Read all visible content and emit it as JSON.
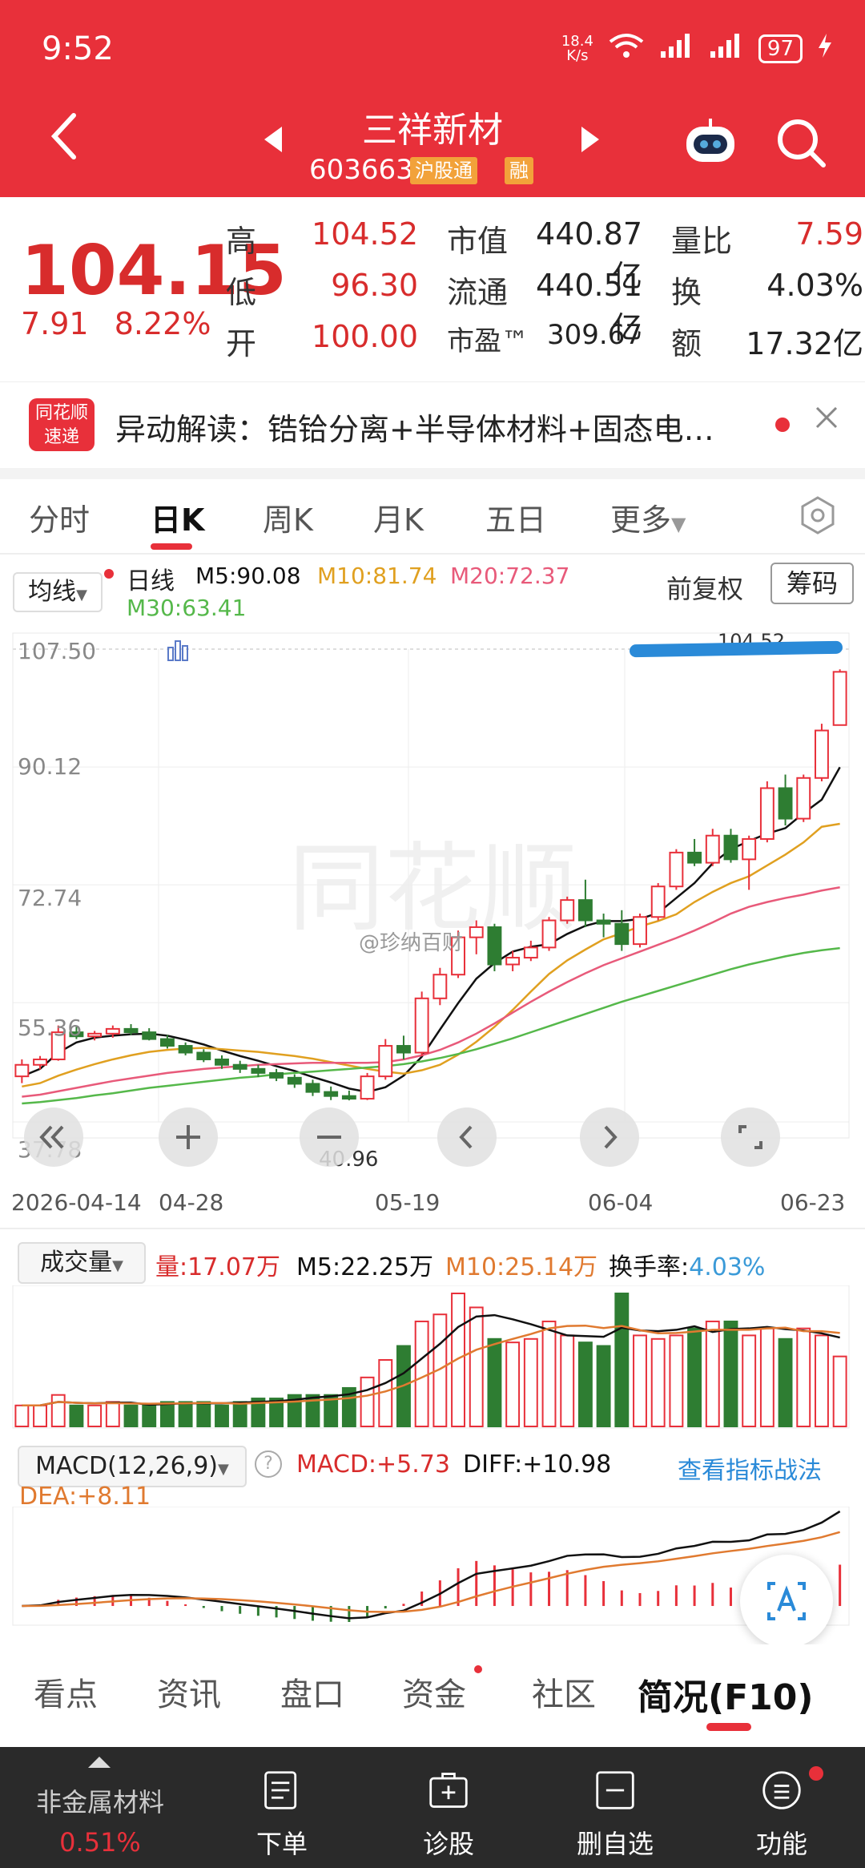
{
  "status": {
    "time": "9:52",
    "speed_value": "18.4",
    "speed_unit": "K/s",
    "battery": "97"
  },
  "stock": {
    "name": "三祥新材",
    "code": "603663",
    "tags": [
      "沪股通",
      "融"
    ]
  },
  "quote": {
    "price": "104.15",
    "change": "7.91",
    "change_pct": "8.22%",
    "cells": [
      {
        "k": "高",
        "v": "104.52"
      },
      {
        "k": "市值",
        "v": "440.87亿"
      },
      {
        "k": "量比",
        "v": "7.59"
      },
      {
        "k": "低",
        "v": "96.30"
      },
      {
        "k": "流通",
        "v": "440.51亿"
      },
      {
        "k": "换",
        "v": "4.03%"
      },
      {
        "k": "开",
        "v": "100.00"
      },
      {
        "k": "市盈™",
        "v": "309.67"
      },
      {
        "k": "额",
        "v": "17.32亿"
      }
    ]
  },
  "notice": {
    "logo_top": "同花顺",
    "logo_bottom": "速递",
    "text": "异动解读：锆铪分离+半导体材料+固态电…"
  },
  "tabs": [
    "分时",
    "日K",
    "周K",
    "月K",
    "五日",
    "更多"
  ],
  "kline": {
    "indicator": "均线",
    "period": "日线",
    "ma5": "M5:90.08",
    "ma10": "M10:81.74",
    "ma20": "M20:72.37",
    "ma30": "M30:63.41",
    "adjust": "前复权",
    "chips": "筹码",
    "high_mark": "104.52",
    "low_mark": "40.96",
    "colors": {
      "ma5": "#111111",
      "ma10": "#e0a020",
      "ma20": "#e85a7a",
      "ma30": "#55b84a"
    }
  },
  "volume": {
    "label": "成交量",
    "vol": "量:17.07万",
    "m5": "M5:22.25万",
    "m10": "M10:25.14万",
    "turnover_label": "换手率:",
    "turnover": "4.03%"
  },
  "macd": {
    "label": "MACD(12,26,9)",
    "macd": "MACD:+5.73",
    "diff": "DIFF:+10.98",
    "dea": "DEA:+8.11",
    "link": "查看指标战法"
  },
  "watermark": "同花顺",
  "weibo": "@珍纳百财",
  "bottom_tabs": [
    "看点",
    "资讯",
    "盘口",
    "资金",
    "社区",
    "简况(F10)"
  ],
  "dock": [
    {
      "label": "非金属材料",
      "sub": "0.51%"
    },
    {
      "label": "下单"
    },
    {
      "label": "诊股"
    },
    {
      "label": "删自选"
    },
    {
      "label": "功能"
    }
  ],
  "chart_data": {
    "type": "candlestick",
    "y_ticks": [
      "107.50",
      "90.12",
      "72.74",
      "55.36",
      "37.78"
    ],
    "x_ticks": [
      "2026-04-14",
      "04-28",
      "05-19",
      "06-04",
      "06-23"
    ],
    "ylim": [
      37.78,
      107.5
    ],
    "candles": [
      [
        44.5,
        47.0,
        43.5,
        46.2
      ],
      [
        46.2,
        47.5,
        45.5,
        47.0
      ],
      [
        47.0,
        52.0,
        46.8,
        51.0
      ],
      [
        51.0,
        51.8,
        50.0,
        50.4
      ],
      [
        50.4,
        51.2,
        49.8,
        50.8
      ],
      [
        50.8,
        52.0,
        50.2,
        51.5
      ],
      [
        51.5,
        52.2,
        50.6,
        51.0
      ],
      [
        51.0,
        51.6,
        49.8,
        50.0
      ],
      [
        50.0,
        50.6,
        48.6,
        49.0
      ],
      [
        49.0,
        49.5,
        47.6,
        48.0
      ],
      [
        48.0,
        48.5,
        46.6,
        47.0
      ],
      [
        47.0,
        47.6,
        45.6,
        46.2
      ],
      [
        46.2,
        46.8,
        45.0,
        45.6
      ],
      [
        45.6,
        46.2,
        44.4,
        45.0
      ],
      [
        45.0,
        45.6,
        43.8,
        44.3
      ],
      [
        44.3,
        44.8,
        42.8,
        43.4
      ],
      [
        43.4,
        44.0,
        41.6,
        42.2
      ],
      [
        42.2,
        43.0,
        41.0,
        41.6
      ],
      [
        41.6,
        42.4,
        40.96,
        41.2
      ],
      [
        41.2,
        45.0,
        41.0,
        44.5
      ],
      [
        44.5,
        50.0,
        44.0,
        49.0
      ],
      [
        49.0,
        50.5,
        47.0,
        48.0
      ],
      [
        48.0,
        57.0,
        47.5,
        56.0
      ],
      [
        56.0,
        60.5,
        55.0,
        59.5
      ],
      [
        59.5,
        66.0,
        59.0,
        65.0
      ],
      [
        65.0,
        67.5,
        62.5,
        66.5
      ],
      [
        66.5,
        67.0,
        60.0,
        61.0
      ],
      [
        61.0,
        63.0,
        60.0,
        62.0
      ],
      [
        62.0,
        64.5,
        61.5,
        63.5
      ],
      [
        63.5,
        68.0,
        63.0,
        67.5
      ],
      [
        67.5,
        71.0,
        67.0,
        70.5
      ],
      [
        70.5,
        73.5,
        66.5,
        67.5
      ],
      [
        67.5,
        68.5,
        65.0,
        67.0
      ],
      [
        67.0,
        69.0,
        63.0,
        64.0
      ],
      [
        64.0,
        68.5,
        63.5,
        68.0
      ],
      [
        68.0,
        73.0,
        67.5,
        72.5
      ],
      [
        72.5,
        78.0,
        72.0,
        77.5
      ],
      [
        77.5,
        79.5,
        75.5,
        76.0
      ],
      [
        76.0,
        81.0,
        75.5,
        80.0
      ],
      [
        80.0,
        81.0,
        76.0,
        76.5
      ],
      [
        76.5,
        80.0,
        72.0,
        79.5
      ],
      [
        79.5,
        88.0,
        79.0,
        87.0
      ],
      [
        87.0,
        89.0,
        81.5,
        82.5
      ],
      [
        82.5,
        89.0,
        82.0,
        88.5
      ],
      [
        88.5,
        96.5,
        88.0,
        95.5
      ],
      [
        96.3,
        104.52,
        96.3,
        104.15
      ]
    ],
    "volume": [
      6,
      6,
      9,
      6,
      6,
      7,
      6,
      6,
      7,
      7,
      7,
      6,
      7,
      8,
      8,
      9,
      9,
      9,
      11,
      14,
      19,
      23,
      30,
      32,
      38,
      34,
      25,
      24,
      25,
      30,
      26,
      24,
      23,
      38,
      26,
      25,
      26,
      28,
      30,
      30,
      26,
      28,
      25,
      28,
      26,
      20
    ],
    "ma_lines": {
      "ma5": [
        44.5,
        45.6,
        48.0,
        49.5,
        50.2,
        50.5,
        50.7,
        50.8,
        50.5,
        49.9,
        49.2,
        48.3,
        47.5,
        46.8,
        46.0,
        45.3,
        44.4,
        43.6,
        42.7,
        42.2,
        42.9,
        44.6,
        47.4,
        51.4,
        55.3,
        58.9,
        61.2,
        62.9,
        63.6,
        64.0,
        65.5,
        66.7,
        67.4,
        67.4,
        67.7,
        68.6,
        70.8,
        73.0,
        75.9,
        78.0,
        79.2,
        80.3,
        81.1,
        83.3,
        85.3,
        90.08
      ],
      "ma10": [
        43.0,
        43.5,
        44.6,
        45.5,
        46.3,
        47.0,
        47.6,
        48.1,
        48.4,
        48.6,
        48.7,
        48.5,
        48.3,
        48.1,
        47.8,
        47.5,
        47.1,
        46.6,
        46.1,
        45.6,
        45.2,
        44.9,
        45.4,
        46.2,
        47.7,
        49.6,
        51.8,
        54.3,
        57.0,
        59.6,
        61.6,
        63.2,
        64.7,
        65.6,
        66.6,
        67.4,
        68.4,
        70.2,
        71.7,
        73.0,
        74.0,
        75.6,
        77.2,
        79.0,
        81.3,
        81.74
      ],
      "ma20": [
        41.5,
        41.8,
        42.3,
        42.8,
        43.3,
        43.8,
        44.2,
        44.6,
        45.0,
        45.3,
        45.6,
        45.8,
        46.0,
        46.2,
        46.3,
        46.4,
        46.5,
        46.5,
        46.5,
        46.5,
        46.6,
        47.0,
        47.6,
        48.4,
        49.5,
        50.8,
        52.3,
        53.9,
        55.5,
        57.0,
        58.4,
        59.7,
        60.9,
        61.9,
        62.9,
        63.9,
        64.9,
        66.0,
        67.2,
        68.5,
        69.5,
        70.2,
        70.8,
        71.3,
        71.9,
        72.37
      ],
      "ma30": [
        40.5,
        40.7,
        41.0,
        41.3,
        41.7,
        42.0,
        42.4,
        42.8,
        43.1,
        43.4,
        43.7,
        44.0,
        44.3,
        44.5,
        44.8,
        45.0,
        45.2,
        45.4,
        45.6,
        45.8,
        46.0,
        46.3,
        46.7,
        47.2,
        47.8,
        48.5,
        49.3,
        50.1,
        51.0,
        51.9,
        52.8,
        53.7,
        54.6,
        55.5,
        56.3,
        57.1,
        57.9,
        58.7,
        59.5,
        60.3,
        61.0,
        61.6,
        62.2,
        62.7,
        63.1,
        63.41
      ]
    }
  }
}
